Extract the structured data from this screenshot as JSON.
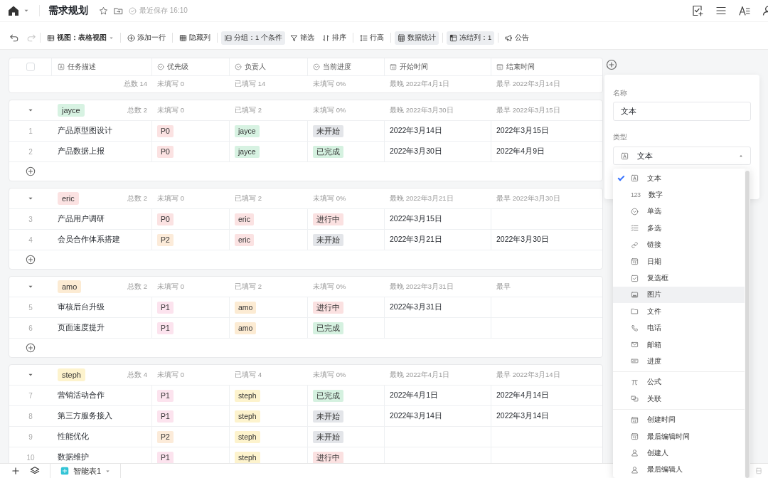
{
  "header": {
    "title": "需求规划",
    "starred": false,
    "save_status": "最近保存 16:10"
  },
  "toolbar": {
    "undo": {
      "disabled": false
    },
    "redo": {
      "disabled": true
    },
    "groups": [
      [
        {
          "label": "视图：表格视图",
          "kind": "menu",
          "active": false
        }
      ],
      [
        {
          "label": "添加一行",
          "kind": "button",
          "active": false
        }
      ],
      [
        {
          "label": "隐藏列",
          "kind": "button",
          "active": false
        }
      ],
      [
        {
          "label": "分组：1 个条件",
          "kind": "button",
          "active": true
        },
        {
          "label": "筛选",
          "kind": "button",
          "active": false
        },
        {
          "label": "排序",
          "kind": "button",
          "active": false
        }
      ],
      [
        {
          "label": "行高",
          "kind": "button",
          "active": false
        }
      ],
      [
        {
          "label": "数据统计",
          "kind": "button",
          "active": true
        }
      ],
      [
        {
          "label": "冻结列：1",
          "kind": "button",
          "active": true
        }
      ],
      [
        {
          "label": "公告",
          "kind": "button",
          "active": false
        }
      ]
    ]
  },
  "table": {
    "select_all_checked": false,
    "columns": [
      {
        "label": "任务描述",
        "kind": "text"
      },
      {
        "label": "优先级",
        "kind": "select"
      },
      {
        "label": "负责人",
        "kind": "select"
      },
      {
        "label": "当前进度",
        "kind": "select"
      },
      {
        "label": "开始时间",
        "kind": "date"
      },
      {
        "label": "结束时间",
        "kind": "date"
      }
    ],
    "summary": {
      "total": "总数 14",
      "stats": [
        "未填写 0",
        "已填写 14",
        "未填写 0%",
        "最晚 2022年4月1日",
        "最早 2022年3月14日"
      ]
    },
    "groups": [
      {
        "name": "jayce",
        "color": "#d7f2e2",
        "expanded": true,
        "total": "总数 2",
        "stats": [
          "未填写 0",
          "已填写 2",
          "未填写 0%",
          "最晚 2022年3月30日",
          "最早 2022年3月15日"
        ],
        "rows": [
          {
            "number": "1",
            "task": "产品原型图设计",
            "priority": {
              "label": "P0",
              "color": "#fbe2e2"
            },
            "owner": {
              "label": "jayce",
              "color": "#d7f2e2"
            },
            "status": {
              "label": "未开始",
              "color": "#e3e5e9"
            },
            "start": "2022年3月14日",
            "end": "2022年3月15日"
          },
          {
            "number": "2",
            "task": "产品数据上报",
            "priority": {
              "label": "P0",
              "color": "#fbe2e2"
            },
            "owner": {
              "label": "jayce",
              "color": "#d7f2e2"
            },
            "status": {
              "label": "已完成",
              "color": "#d5f1e0"
            },
            "start": "2022年3月30日",
            "end": "2022年4月9日"
          }
        ]
      },
      {
        "name": "eric",
        "color": "#fbe2e2",
        "expanded": true,
        "total": "总数 2",
        "stats": [
          "未填写 0",
          "已填写 2",
          "未填写 0%",
          "最晚 2022年3月21日",
          "最早 2022年3月30日"
        ],
        "rows": [
          {
            "number": "3",
            "task": "产品用户调研",
            "priority": {
              "label": "P0",
              "color": "#fbe2e2"
            },
            "owner": {
              "label": "eric",
              "color": "#fbe2e2"
            },
            "status": {
              "label": "进行中",
              "color": "#fbe1e1"
            },
            "start": "2022年3月15日"
          },
          {
            "number": "4",
            "task": "会员合作体系搭建",
            "priority": {
              "label": "P2",
              "color": "#fcebd9"
            },
            "owner": {
              "label": "eric",
              "color": "#fbe2e2"
            },
            "status": {
              "label": "未开始",
              "color": "#e3e5e9"
            },
            "start": "2022年3月21日",
            "end": "2022年3月30日"
          }
        ]
      },
      {
        "name": "amo",
        "color": "#fcebd3",
        "expanded": true,
        "total": "总数 2",
        "stats": [
          "未填写 0",
          "已填写 2",
          "未填写 0%",
          "最晚 2022年3月31日",
          "最早"
        ],
        "rows": [
          {
            "number": "5",
            "task": "审核后台升级",
            "priority": {
              "label": "P1",
              "color": "#fce3ee"
            },
            "owner": {
              "label": "amo",
              "color": "#fcebd3"
            },
            "status": {
              "label": "进行中",
              "color": "#fbe1e1"
            },
            "start": "2022年3月31日"
          },
          {
            "number": "6",
            "task": "页面速度提升",
            "priority": {
              "label": "P1",
              "color": "#fce3ee"
            },
            "owner": {
              "label": "amo",
              "color": "#fcebd3"
            },
            "status": {
              "label": "已完成",
              "color": "#d5f1e0"
            }
          }
        ]
      },
      {
        "name": "steph",
        "color": "#fdf3cd",
        "expanded": true,
        "total": "总数 4",
        "stats": [
          "未填写 0",
          "已填写 4",
          "未填写 0%",
          "最晚 2022年4月1日",
          "最早 2022年3月14日"
        ],
        "rows": [
          {
            "number": "7",
            "task": "营销活动合作",
            "priority": {
              "label": "P1",
              "color": "#fce3ee"
            },
            "owner": {
              "label": "steph",
              "color": "#fdf3cd"
            },
            "status": {
              "label": "已完成",
              "color": "#d5f1e0"
            },
            "start": "2022年4月1日",
            "end": "2022年4月14日"
          },
          {
            "number": "8",
            "task": "第三方服务接入",
            "priority": {
              "label": "P1",
              "color": "#fce3ee"
            },
            "owner": {
              "label": "steph",
              "color": "#fdf3cd"
            },
            "status": {
              "label": "未开始",
              "color": "#e3e5e9"
            },
            "start": "2022年3月14日",
            "end": "2022年3月14日"
          },
          {
            "number": "9",
            "task": "性能优化",
            "priority": {
              "label": "P2",
              "color": "#fcebd9"
            },
            "owner": {
              "label": "steph",
              "color": "#fdf3cd"
            },
            "status": {
              "label": "未开始",
              "color": "#e3e5e9"
            }
          },
          {
            "number": "10",
            "task": "数据维护",
            "priority": {
              "label": "P1",
              "color": "#fce3ee"
            },
            "owner": {
              "label": "steph",
              "color": "#fdf3cd"
            },
            "status": {
              "label": "进行中",
              "color": "#fbe1e1"
            }
          }
        ]
      }
    ]
  },
  "field_panel": {
    "name_label": "名称",
    "name_value": "文本",
    "type_label": "类型",
    "type_value": "文本",
    "option_groups": [
      [
        {
          "label": "文本",
          "kind": "text",
          "selected": true,
          "highlighted": false
        },
        {
          "label": "数字",
          "kind": "number",
          "glyph": "123",
          "selected": false,
          "highlighted": false
        },
        {
          "label": "单选",
          "kind": "single_select",
          "selected": false,
          "highlighted": false
        },
        {
          "label": "多选",
          "kind": "multi_select",
          "selected": false,
          "highlighted": false
        },
        {
          "label": "链接",
          "kind": "link",
          "selected": false,
          "highlighted": false
        },
        {
          "label": "日期",
          "kind": "date",
          "selected": false,
          "highlighted": false
        },
        {
          "label": "复选框",
          "kind": "checkbox",
          "selected": false,
          "highlighted": false
        },
        {
          "label": "图片",
          "kind": "image",
          "selected": false,
          "highlighted": true
        },
        {
          "label": "文件",
          "kind": "file",
          "selected": false,
          "highlighted": false
        },
        {
          "label": "电话",
          "kind": "phone",
          "selected": false,
          "highlighted": false
        },
        {
          "label": "邮箱",
          "kind": "email",
          "selected": false,
          "highlighted": false
        },
        {
          "label": "进度",
          "kind": "progress",
          "selected": false,
          "highlighted": false
        }
      ],
      [
        {
          "label": "公式",
          "kind": "formula",
          "selected": false,
          "highlighted": false
        },
        {
          "label": "关联",
          "kind": "relation",
          "selected": false,
          "highlighted": false
        }
      ],
      [
        {
          "label": "创建时间",
          "kind": "created_time",
          "selected": false,
          "highlighted": false
        },
        {
          "label": "最后编辑时间",
          "kind": "modified_time",
          "selected": false,
          "highlighted": false
        },
        {
          "label": "创建人",
          "kind": "creator",
          "selected": false,
          "highlighted": false
        },
        {
          "label": "最后编辑人",
          "kind": "modifier",
          "selected": false,
          "highlighted": false
        }
      ]
    ]
  },
  "bottom_bar": {
    "sheets": [
      {
        "label": "智能表1",
        "selected": true
      }
    ]
  }
}
